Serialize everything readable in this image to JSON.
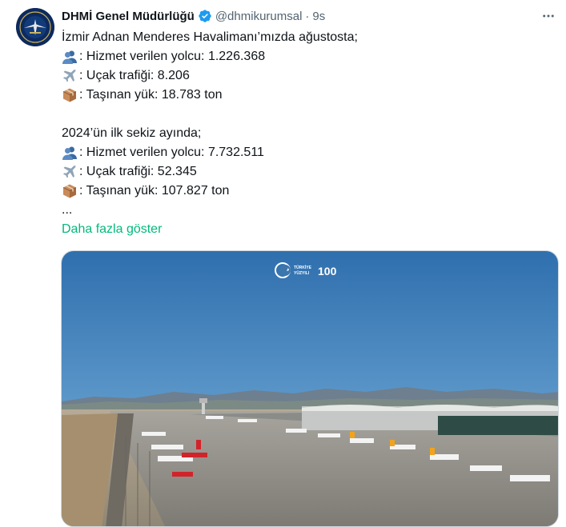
{
  "account": {
    "name": "DHMİ Genel Müdürlüğü",
    "handle": "@dhmikurumsal",
    "separator": "·",
    "time": "9s"
  },
  "icons": {
    "verified": "verified-badge-icon",
    "more": "more-icon",
    "passenger": "busts-in-silhouette-emoji",
    "plane": "airplane-emoji",
    "cargo": "package-emoji"
  },
  "tweet": {
    "intro": "İzmir Adnan Menderes Havalimanı’mızda ağustosta;",
    "august_stats": [
      {
        "icon": "passenger",
        "text": ": Hizmet verilen yolcu: 1.226.368"
      },
      {
        "icon": "plane",
        "text": ": Uçak trafiği: 8.206"
      },
      {
        "icon": "cargo",
        "text": ": Taşınan yük: 18.783 ton"
      }
    ],
    "period_heading": "2024’ün ilk sekiz ayında;",
    "period_stats": [
      {
        "icon": "passenger",
        "text": ": Hizmet verilen yolcu: 7.732.511"
      },
      {
        "icon": "plane",
        "text": ": Uçak trafiği: 52.345"
      },
      {
        "icon": "cargo",
        "text": ": Taşınan yük: 107.827 ton"
      }
    ],
    "ellipsis": "...",
    "show_more": "Daha fazla göster"
  },
  "media": {
    "watermark_left_top": "TÜRKİYE",
    "watermark_left_bottom": "YÜZYILI",
    "watermark_right": "100"
  },
  "colors": {
    "link": "#00ba7c",
    "secondary_text": "#536471",
    "verified_blue": "#1d9bf0",
    "avatar_bg": "#0d2a5e"
  }
}
